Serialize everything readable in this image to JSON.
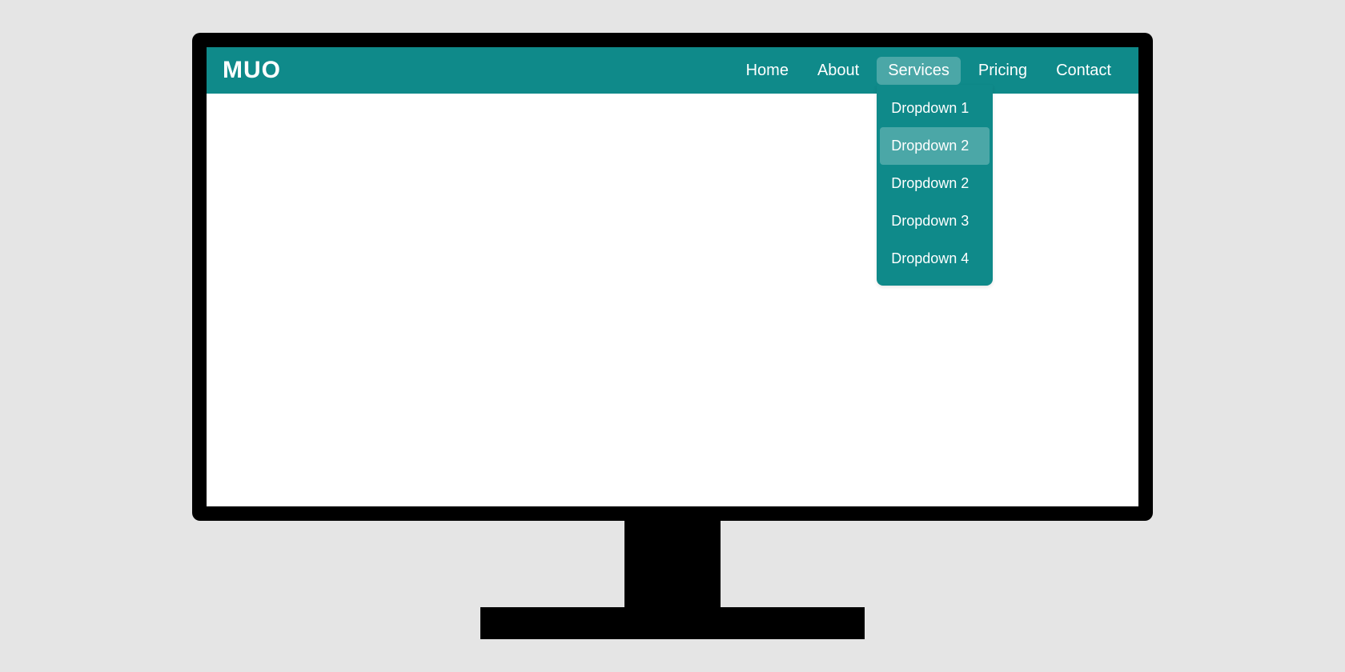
{
  "logo": "MUO",
  "nav": {
    "items": [
      {
        "label": "Home",
        "active": false,
        "dropdown": null
      },
      {
        "label": "About",
        "active": false,
        "dropdown": null
      },
      {
        "label": "Services",
        "active": true,
        "dropdown": [
          {
            "label": "Dropdown 1",
            "hovered": false
          },
          {
            "label": "Dropdown 2",
            "hovered": true
          },
          {
            "label": "Dropdown 2",
            "hovered": false
          },
          {
            "label": "Dropdown 3",
            "hovered": false
          },
          {
            "label": "Dropdown 4",
            "hovered": false
          }
        ]
      },
      {
        "label": "Pricing",
        "active": false,
        "dropdown": null
      },
      {
        "label": "Contact",
        "active": false,
        "dropdown": null
      }
    ]
  },
  "colors": {
    "navbar_bg": "#0f8a8a",
    "navbar_text": "#ffffff",
    "highlight_bg": "rgba(255,255,255,0.25)"
  }
}
